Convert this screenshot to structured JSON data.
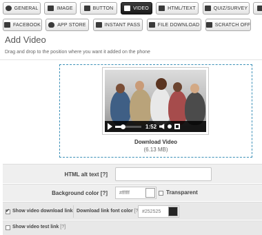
{
  "toolbar": {
    "row1": [
      {
        "label": "GENERAL",
        "icon": "gear-icon",
        "active": false
      },
      {
        "label": "IMAGE",
        "icon": "image-icon",
        "active": false
      },
      {
        "label": "BUTTON",
        "icon": "button-icon",
        "active": false
      },
      {
        "label": "VIDEO",
        "icon": "video-icon",
        "active": true
      },
      {
        "label": "HTML/TEXT",
        "icon": "html-icon",
        "active": false
      },
      {
        "label": "QUIZ/SURVEY",
        "icon": "quiz-icon",
        "active": false
      },
      {
        "label": "",
        "icon": "more-icon",
        "active": false
      }
    ],
    "row2": [
      {
        "label": "FACEBOOK",
        "icon": "facebook-icon"
      },
      {
        "label": "APP STORE",
        "icon": "apple-icon"
      },
      {
        "label": "INSTANT PASS",
        "icon": "pass-icon"
      },
      {
        "label": "FILE DOWNLOAD",
        "icon": "download-icon"
      },
      {
        "label": "SCRATCH OFF",
        "icon": "scratch-icon"
      }
    ]
  },
  "page": {
    "title": "Add Video",
    "subtitle": "Drag and drop to the position where you want it added on the phone"
  },
  "video": {
    "time": "1:52",
    "progress": 0.28,
    "download_label": "Download Video",
    "file_size": "(6.13 MB)"
  },
  "form": {
    "alt_text_label": "HTML alt text",
    "alt_text_help": "[?]",
    "alt_text_value": "",
    "bg_color_label": "Background color",
    "bg_color_help": "[?]",
    "bg_color_value": "#ffffff",
    "transparent_label": "Transparent",
    "transparent_checked": false,
    "show_download_label": "Show video download link",
    "show_download_checked": true,
    "link_font_color_label": "Download link font color",
    "link_font_color_help": "[?]",
    "link_font_color_value": "#252525",
    "show_test_label": "Show video test link",
    "show_test_help": "[?]",
    "show_test_checked": false
  },
  "colors": {
    "accent": "#3a8fb7",
    "active_tab": "#1a1a1a",
    "bg_swatch": "#ffffff",
    "link_swatch": "#252525"
  }
}
